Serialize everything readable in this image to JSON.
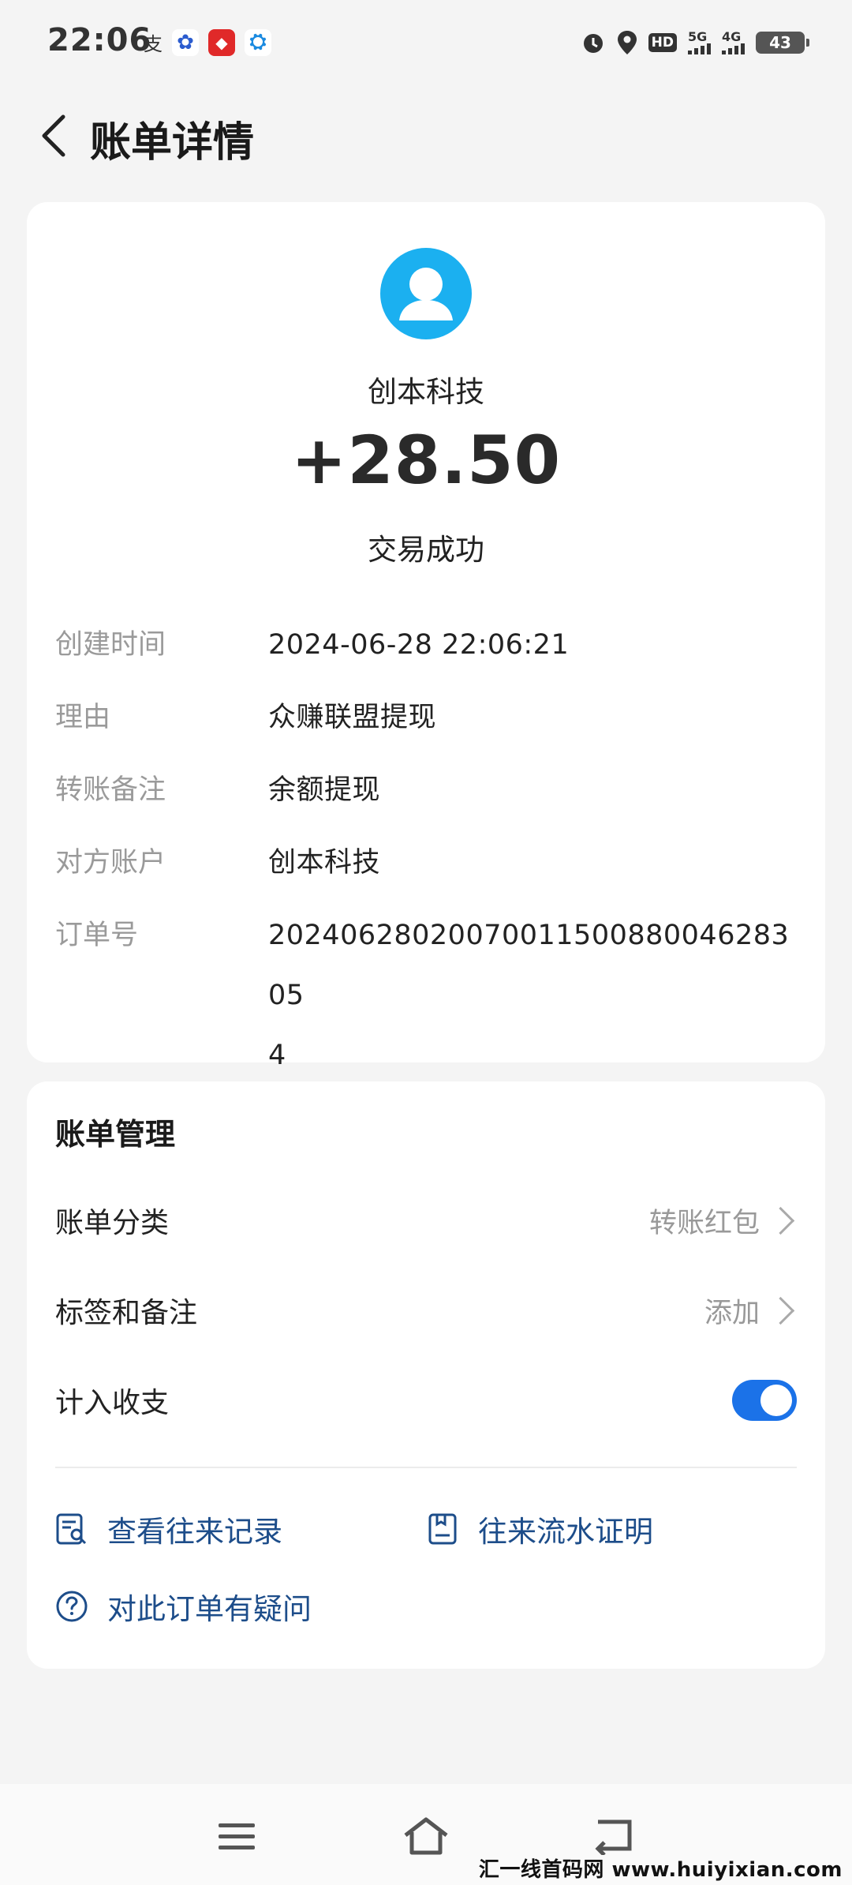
{
  "status_bar": {
    "time": "22:06",
    "icons": [
      "alipay-icon",
      "baidu-icon",
      "app-icon-red",
      "app-icon-blue",
      "alarm-icon",
      "location-icon",
      "hd-icon",
      "signal-5g-icon",
      "signal-4g-icon",
      "battery-icon"
    ],
    "hd_label": "HD",
    "net1_label": "5G",
    "net2_label": "4G",
    "battery_level": "43"
  },
  "header": {
    "title": "账单详情"
  },
  "summary": {
    "merchant": "创本科技",
    "amount": "+28.50",
    "status": "交易成功",
    "avatar_color": "#1bb0f0"
  },
  "details": [
    {
      "label": "创建时间",
      "value": "2024-06-28 22:06:21"
    },
    {
      "label": "理由",
      "value": "众赚联盟提现"
    },
    {
      "label": "转账备注",
      "value": "余额提现"
    },
    {
      "label": "对方账户",
      "value": "创本科技"
    },
    {
      "label": "订单号",
      "value": "2024062802007001150088004628305 4"
    }
  ],
  "manage": {
    "title": "账单管理",
    "category_label": "账单分类",
    "category_value": "转账红包",
    "tag_label": "标签和备注",
    "tag_value": "添加",
    "include_label": "计入收支",
    "include_on": true,
    "links": {
      "history": "查看往来记录",
      "proof": "往来流水证明",
      "question": "对此订单有疑问"
    },
    "accent_color": "#1b72e8",
    "link_color": "#1d4d8a"
  },
  "watermark": "汇一线首码网 www.huiyixian.com"
}
